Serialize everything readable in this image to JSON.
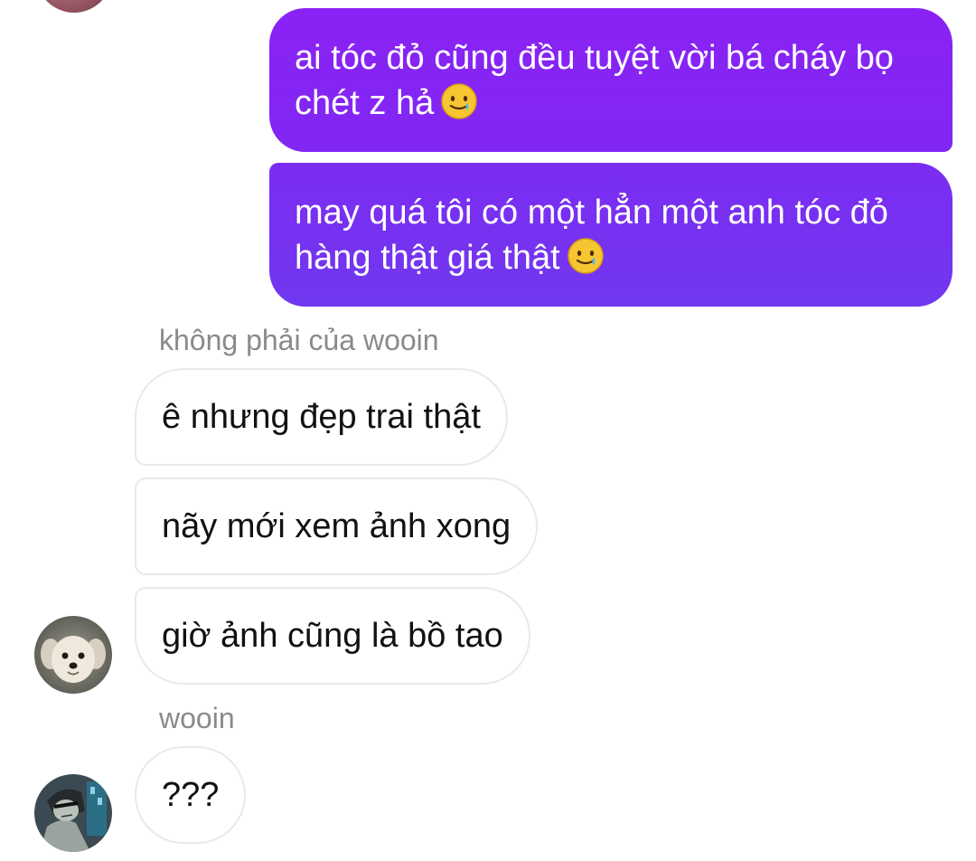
{
  "messages": {
    "outgoing": [
      {
        "text": "ai tóc đỏ cũng đều tuyệt vời bá cháy bọ chét z hả",
        "emoji": "smiling-face-with-tear"
      },
      {
        "text": "may quá tôi có một hẳn một anh tóc đỏ hàng thật giá thật",
        "emoji": "smiling-face-with-tear"
      }
    ],
    "incoming_group_1": {
      "sender_label": "không phải của wooin",
      "bubbles": [
        {
          "text": "ê nhưng đẹp trai thật"
        },
        {
          "text": "nãy mới xem ảnh xong"
        },
        {
          "text": "giờ ảnh cũng là bồ tao"
        }
      ]
    },
    "incoming_group_2": {
      "sender_label": "wooin",
      "bubbles": [
        {
          "text": "???"
        }
      ]
    }
  },
  "colors": {
    "outgoing_bubble_top": "#8a22f5",
    "outgoing_bubble_bottom": "#7038ef",
    "incoming_border": "#e9e9ec",
    "sender_label": "#8a8a8a"
  }
}
